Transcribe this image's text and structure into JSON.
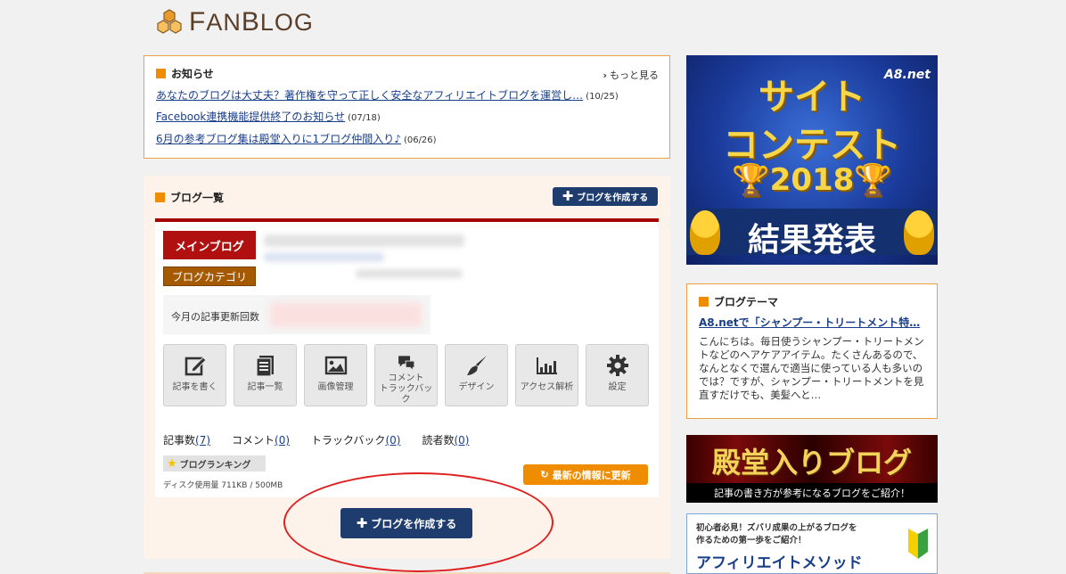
{
  "logo": {
    "text_first": "F",
    "text_rest": "AN",
    "text_b": "B",
    "text_end": "LOG"
  },
  "notice": {
    "title": "お知らせ",
    "more": "もっと見る",
    "items": [
      {
        "text": "あなたのブログは大丈夫？著作権を守って正しく安全なアフィリエイトブログを運営し…",
        "date": "(10/25)"
      },
      {
        "text": "Facebook連携機能提供終了のお知らせ",
        "date": "(07/18)"
      },
      {
        "text": "6月の参考ブログ集は殿堂入りに1ブログ仲間入り♪",
        "date": "(06/26)"
      }
    ]
  },
  "bloglist": {
    "title": "ブログ一覧",
    "create_small": "ブログを作成する",
    "main_tag": "メインブログ",
    "category_tag": "ブログカテゴリ",
    "stats_label": "今月の記事更新回数",
    "tools": [
      {
        "icon": "edit-icon",
        "label": "記事を書く"
      },
      {
        "icon": "article-list-icon",
        "label": "記事一覧"
      },
      {
        "icon": "image-icon",
        "label": "画像管理"
      },
      {
        "icon": "comment-icon",
        "label1": "コメント",
        "label2": "トラックバック"
      },
      {
        "icon": "brush-icon",
        "label": "デザイン"
      },
      {
        "icon": "bar-chart-icon",
        "label": "アクセス解析"
      },
      {
        "icon": "gear-icon",
        "label": "設定"
      }
    ],
    "counts": {
      "articles_label": "記事数",
      "articles": "(7)",
      "comments_label": "コメント",
      "comments": "(0)",
      "trackbacks_label": "トラックバック",
      "trackbacks": "(0)",
      "readers_label": "読者数",
      "readers": "(0)"
    },
    "ranking": "ブログランキング",
    "disk": "ディスク使用量 711KB / 500MB",
    "update": "最新の情報に更新",
    "create_big": "ブログを作成する"
  },
  "ads": {
    "a8": {
      "logo": "A8.net",
      "line1": "サイト",
      "line2": "コンテスト",
      "year": "2018",
      "result": "結果発表"
    },
    "dendo": {
      "title": "殿堂入りブログ",
      "sub": "記事の書き方が参考になるブログをご紹介！"
    },
    "method": {
      "line1": "初心者必見！ズバリ成果の上がるブログを",
      "line2": "作るための第一歩をご紹介！",
      "title": "アフィリエイトメソッド"
    }
  },
  "theme": {
    "title": "ブログテーマ",
    "link": "A8.netで「シャンプー・トリートメント特…",
    "text": "こんにちは。毎日使うシャンプー・トリートメントなどのヘアケアアイテム。たくさんあるので、なんとなくで選んで適当に使っている人も多いのでは？ですが、シャンプー・トリートメントを見直すだけでも、美髪へと…"
  },
  "colors": {
    "accent": "#f08c00",
    "navy": "#1e3c6e",
    "main_red": "#b01010",
    "link": "#1a3f8a"
  }
}
